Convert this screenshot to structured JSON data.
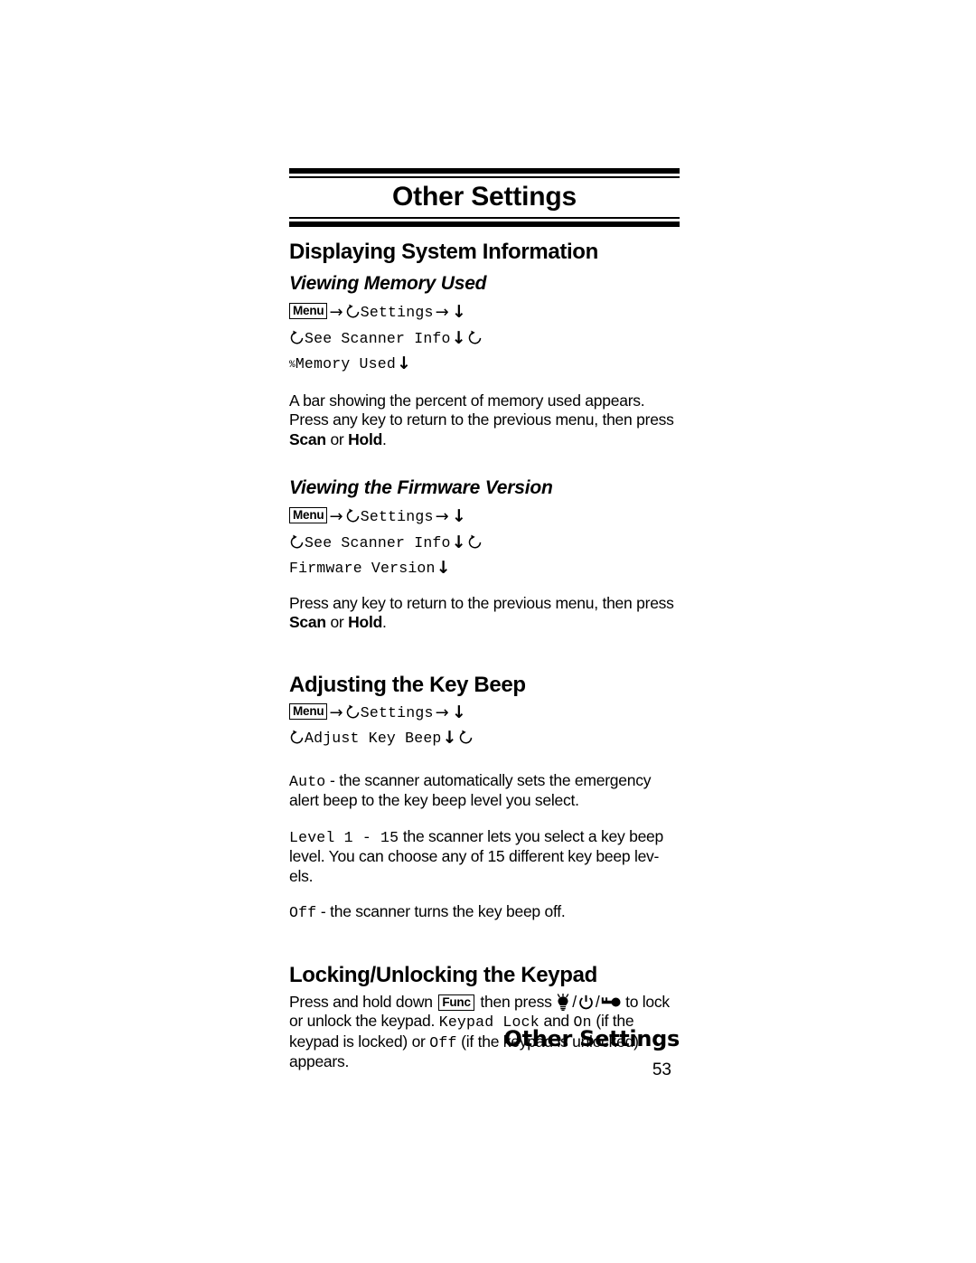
{
  "chapter": {
    "title": "Other Settings"
  },
  "sections": {
    "displaying_system_information": {
      "heading": "Displaying System Information",
      "viewing_memory_used": {
        "heading": "Viewing Memory Used",
        "path": {
          "menu_key": "Menu",
          "settings_label": "Settings",
          "see_scanner_info_label": "See Scanner Info",
          "memory_used_label": "Memory Used",
          "percent_symbol": "%",
          "arrow_right": "→",
          "arrow_down": "↓"
        },
        "paragraph": {
          "line1": "A bar showing the percent of memory used appears.",
          "line2": "Press any key to return to the previous menu, then",
          "line3_pre": "press ",
          "scan_key": "Scan",
          "line3_mid": " or ",
          "hold_key": "Hold",
          "line3_end": "."
        }
      },
      "viewing_the_firmware_version": {
        "heading": "Viewing the Firmware Version",
        "path": {
          "menu_key": "Menu",
          "settings_label": "Settings",
          "see_scanner_info_label": "See Scanner Info",
          "firmware_version_label": "Firmware Version"
        },
        "paragraph": {
          "line1": "Press any key to return to the previous menu, then",
          "line2_pre": "press ",
          "scan_key": "Scan",
          "line2_mid": " or ",
          "hold_key": "Hold",
          "line2_end": "."
        }
      }
    },
    "adjusting_the_key_beep": {
      "heading": "Adjusting the Key Beep",
      "path": {
        "menu_key": "Menu",
        "settings_label": "Settings",
        "adjust_key_beep_label": "Adjust Key Beep"
      },
      "options": {
        "auto": {
          "value": "Auto",
          "text": " - the scanner automatically sets the emergency alert beep to the key beep level you select."
        },
        "level": {
          "value": "Level 1 - 15",
          "text": " the scanner lets you select a key beep level. You can choose any of 15 different key beep lev-els."
        },
        "off": {
          "value": "Off",
          "text": " - the scanner turns the key beep off."
        }
      }
    },
    "locking_unlocking_the_keypad": {
      "heading": "Locking/Unlocking the Keypad",
      "paragraph": {
        "pre": "Press and hold down ",
        "func_key": "Func",
        "mid": " then press ",
        "post_icons": " to lock or unlock the keypad. ",
        "keypad_lock_value": "Keypad Lock",
        "and_text": " and ",
        "on_value": "On",
        "locked_note": " (if the keypad is locked) or ",
        "off_value": "Off",
        "unlocked_note": " (if the keypad is unlocked) appears."
      },
      "icons": {
        "light_icon": "light-bulb-icon",
        "power_icon": "power-icon",
        "key_icon": "key-icon",
        "separator": "/"
      }
    }
  },
  "footer": {
    "title": "Other Settings",
    "page_number": "53"
  },
  "colors": {
    "ink": "#000000",
    "paper": "#ffffff",
    "display_text": "#3a3a3a"
  }
}
